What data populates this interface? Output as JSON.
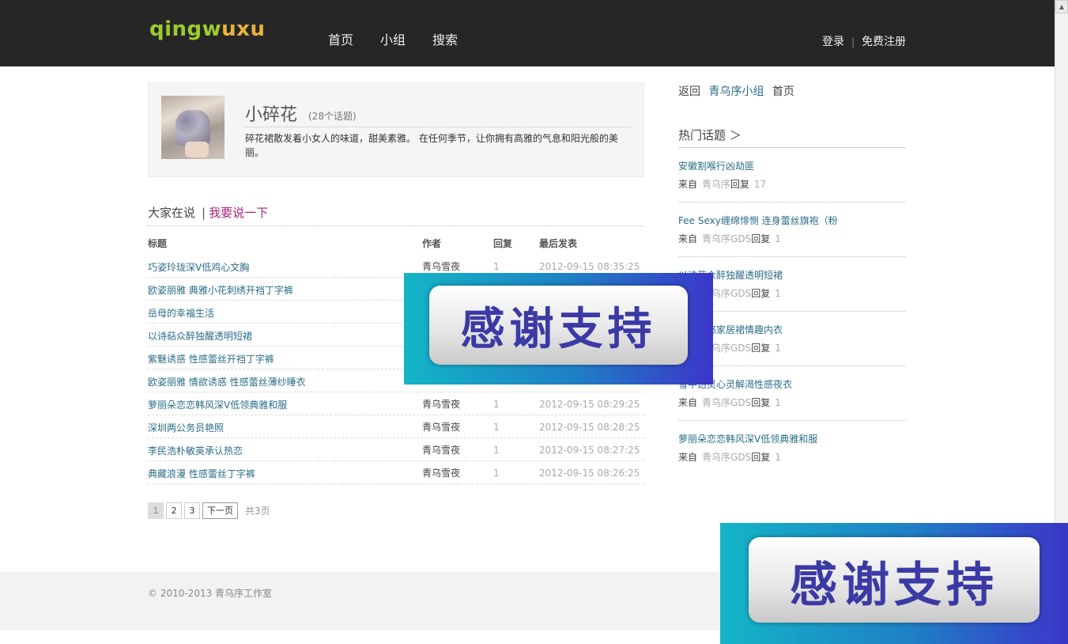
{
  "header": {
    "logo_text_main": "qingw",
    "logo_text_accent": "uxu",
    "nav": [
      "首页",
      "小组",
      "搜索"
    ],
    "login": "登录",
    "separator": "|",
    "register": "免费注册"
  },
  "group": {
    "name": "小碎花",
    "topic_count": "(28个话题)",
    "description": "碎花裙散发着小女人的味道，甜美素雅。 在任何季节，让你拥有高雅的气息和阳光般的美丽。"
  },
  "discussion": {
    "heading": "大家在说",
    "bar": "|",
    "post_link": "我要说一下",
    "columns": {
      "title": "标题",
      "author": "作者",
      "reply": "回复",
      "last": "最后发表"
    },
    "rows": [
      {
        "title": "巧姿玲珑深V低鸡心文胸",
        "author": "青乌雪夜",
        "reply": "1",
        "time": "2012-09-15 08:35:25"
      },
      {
        "title": "欧姿丽雅 典雅小花刺绣开裆丁字裤",
        "author": "",
        "reply": "",
        "time": ""
      },
      {
        "title": "岳母的幸福生活",
        "author": "",
        "reply": "",
        "time": ""
      },
      {
        "title": "以诗萜众醉独醒透明短裙",
        "author": "",
        "reply": "",
        "time": ""
      },
      {
        "title": "紫魅诱惑 性感蕾丝开裆丁字裤",
        "author": "",
        "reply": "",
        "time": ""
      },
      {
        "title": "欧姿丽雅 情欲诱惑 性感蕾丝薄纱睡衣",
        "author": "",
        "reply": "",
        "time": ""
      },
      {
        "title": "萝丽朵恋恋韩风深V低领典雅和服",
        "author": "青乌雪夜",
        "reply": "1",
        "time": "2012-09-15 08:29:25"
      },
      {
        "title": "深圳两公务员艳照",
        "author": "青乌雪夜",
        "reply": "1",
        "time": "2012-09-15 08:28:25"
      },
      {
        "title": "李民浩朴敏英承认热恋",
        "author": "青乌雪夜",
        "reply": "1",
        "time": "2012-09-15 08:27:25"
      },
      {
        "title": "典藏浪漫 性感蕾丝丁字裤",
        "author": "青乌雪夜",
        "reply": "1",
        "time": "2012-09-15 08:26:25"
      }
    ]
  },
  "pager": {
    "pages": [
      "1",
      "2",
      "3"
    ],
    "next": "下一页",
    "total": "共3页"
  },
  "sidebar": {
    "back_prefix": "返回",
    "back_group": "青乌序小组",
    "back_home": "首页",
    "hot_title": "热门话题 ＞",
    "hot": [
      {
        "title": "安徽割喉行凶劫匪",
        "from": "来自",
        "group": "青乌序",
        "reply_label": "回复",
        "count": "17"
      },
      {
        "title": "Fee Sexy缠绵悱恻 连身蕾丝旗袍（粉",
        "from": "来自",
        "group": "青乌序GDS",
        "reply_label": "回复",
        "count": "1"
      },
      {
        "title": "以诗萜众醉独醒透明短裙",
        "from": "来自",
        "group": "青乌序GDS",
        "reply_label": "回复",
        "count": "1"
      },
      {
        "title": "曼黛思悠家居裙情趣内衣",
        "from": "来自",
        "group": "青乌序GDS",
        "reply_label": "回复",
        "count": "1"
      },
      {
        "title": "雪中透灵心灵解渴性感夜衣",
        "from": "来自",
        "group": "青乌序GDS",
        "reply_label": "回复",
        "count": "1"
      },
      {
        "title": "萝丽朵恋恋韩风深V低领典雅和服",
        "from": "来自",
        "group": "青乌序GDS",
        "reply_label": "回复",
        "count": "1"
      }
    ]
  },
  "footer": {
    "copyright": "© 2010-2013 青乌序工作室"
  },
  "overlays": {
    "banner_text": "感谢支持"
  },
  "colors": {
    "header_bg": "#262626",
    "link": "#2a6c8a",
    "accent": "#a9237a",
    "logo_green": "#9ccc2e"
  }
}
